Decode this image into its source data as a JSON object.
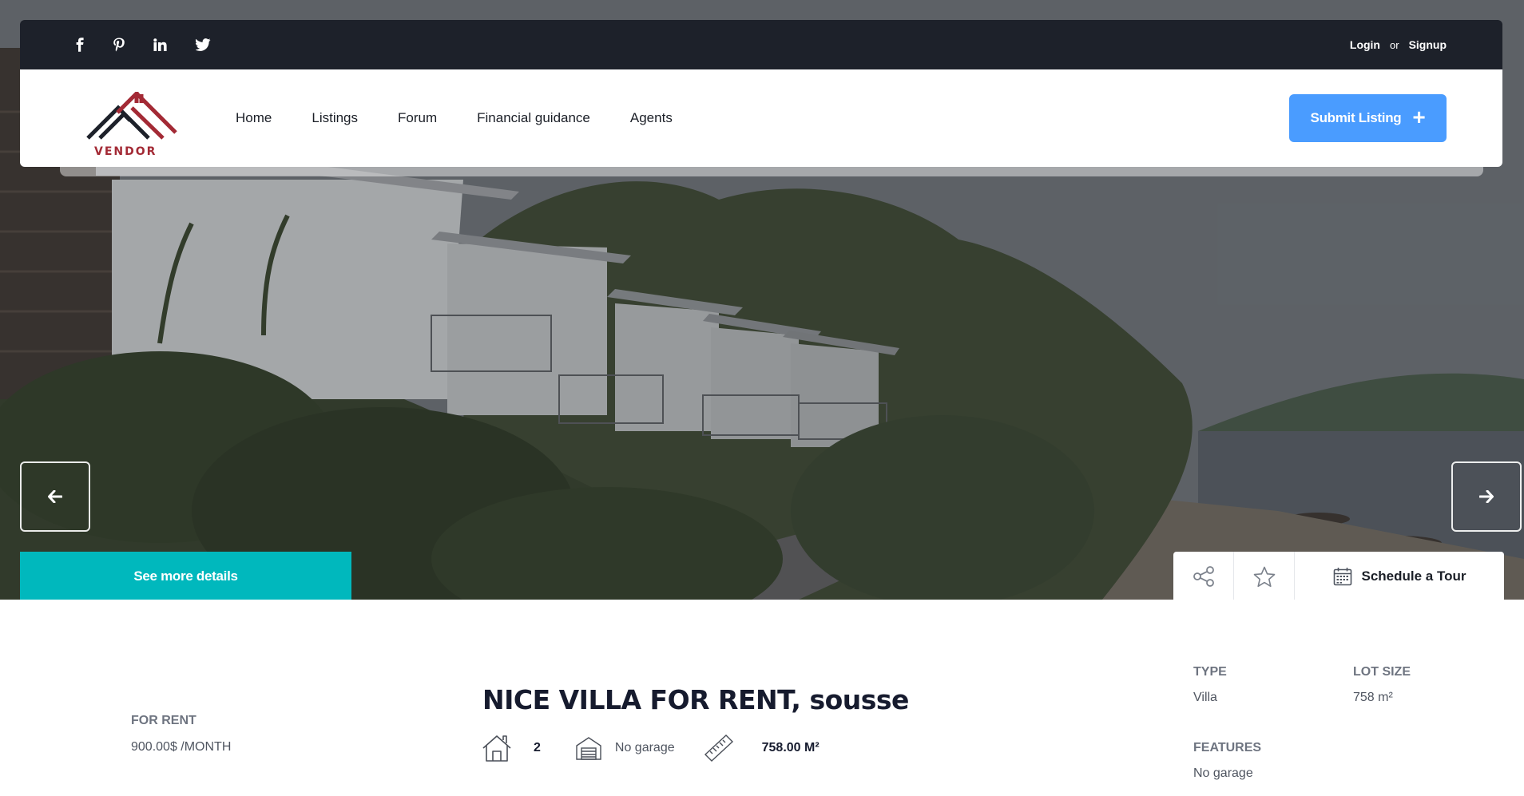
{
  "topbar": {
    "social_icons": [
      "facebook-icon",
      "pinterest-icon",
      "linkedin-icon",
      "twitter-icon"
    ],
    "login_label": "Login",
    "or_label": "or",
    "signup_label": "Signup"
  },
  "brand": {
    "logo_text": "VENDOR",
    "logo_color": "#a32a35"
  },
  "nav": {
    "items": [
      "Home",
      "Listings",
      "Forum",
      "Financial guidance",
      "Agents"
    ],
    "submit_label": "Submit Listing"
  },
  "hero": {
    "prev_icon": "arrow-left-icon",
    "next_icon": "arrow-right-icon",
    "see_more_label": "See more details",
    "schedule_label": "Schedule a Tour"
  },
  "listing": {
    "status_label": "FOR RENT",
    "price": "900.00$ /MONTH",
    "title": "NICE VILLA FOR RENT, sousse",
    "bedrooms": "2",
    "garage": "No garage",
    "size": "758.00 M²",
    "type_label": "TYPE",
    "type_value": "Villa",
    "lot_label": "LOT SIZE",
    "lot_value": "758 m²",
    "features_label": "FEATURES",
    "features_value": "No garage"
  },
  "colors": {
    "topbar_bg": "#1d212a",
    "accent_blue": "#4a9cff",
    "accent_teal": "#00b8bd"
  }
}
